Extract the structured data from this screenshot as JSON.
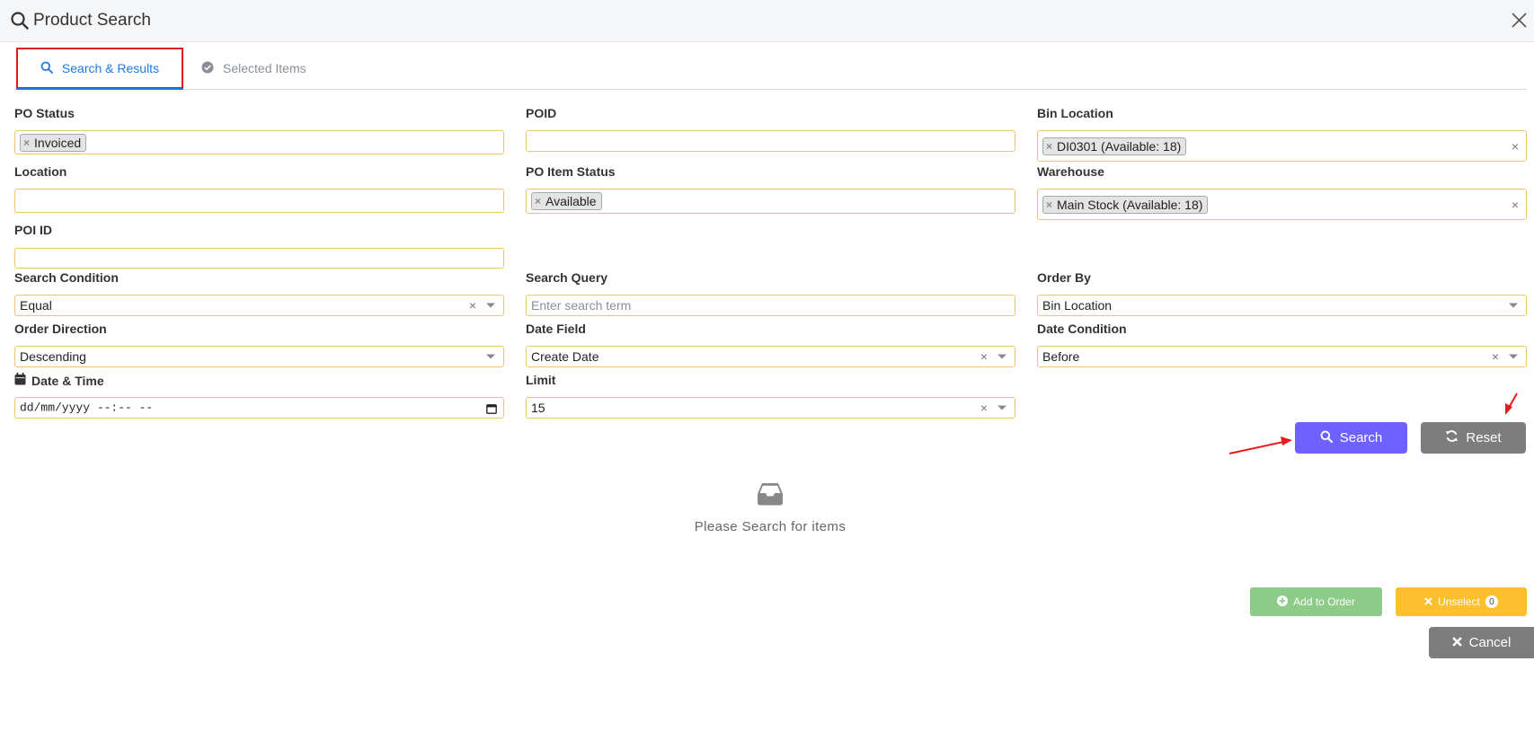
{
  "header": {
    "title": "Product Search"
  },
  "tabs": [
    {
      "label": "Search & Results",
      "active": true
    },
    {
      "label": "Selected Items",
      "active": false
    }
  ],
  "fields": {
    "po_status": {
      "label": "PO Status",
      "tags": [
        "Invoiced"
      ]
    },
    "poid": {
      "label": "POID",
      "value": ""
    },
    "bin_location": {
      "label": "Bin Location",
      "tags": [
        "DI0301 (Available: 18)"
      ]
    },
    "location": {
      "label": "Location",
      "value": ""
    },
    "po_item_status": {
      "label": "PO Item Status",
      "tags": [
        "Available"
      ]
    },
    "warehouse": {
      "label": "Warehouse",
      "tags": [
        "Main Stock (Available: 18)"
      ]
    },
    "poi_id": {
      "label": "POI ID",
      "value": ""
    },
    "search_condition": {
      "label": "Search Condition",
      "value": "Equal"
    },
    "search_query": {
      "label": "Search Query",
      "placeholder": "Enter search term",
      "value": ""
    },
    "order_by": {
      "label": "Order By",
      "value": "Bin Location"
    },
    "order_direction": {
      "label": "Order Direction",
      "value": "Descending"
    },
    "date_field": {
      "label": "Date Field",
      "value": "Create Date"
    },
    "date_condition": {
      "label": "Date Condition",
      "value": "Before"
    },
    "date_time": {
      "label": "Date & Time",
      "value": "dd/mm/yyyy --:-- --"
    },
    "limit": {
      "label": "Limit",
      "value": "15"
    }
  },
  "actions": {
    "search_label": "Search",
    "reset_label": "Reset",
    "add_to_order_label": "Add to Order",
    "unselect_label": "Unselect",
    "unselect_count": "0",
    "cancel_label": "Cancel"
  },
  "empty_state": {
    "text": "Please Search for items"
  },
  "colors": {
    "accent_blue": "#1f7ae0",
    "highlight_red": "#e01d1d",
    "search_button": "#6f61ff",
    "reset_button": "#7d7d7d",
    "add_button": "#8ccb88",
    "unselect_button": "#fdbf2d",
    "field_border": "#f3c46c",
    "annotation_arrow": "#e51c1c"
  },
  "icons": {
    "header": "search-icon",
    "close": "close-icon",
    "tab_search": "search-icon",
    "tab_selected": "check-circle-icon",
    "date": "calendar-icon",
    "empty": "inbox-icon",
    "reset": "refresh-icon",
    "add": "plus-circle-icon",
    "unselect": "x-icon",
    "cancel": "x-icon"
  }
}
